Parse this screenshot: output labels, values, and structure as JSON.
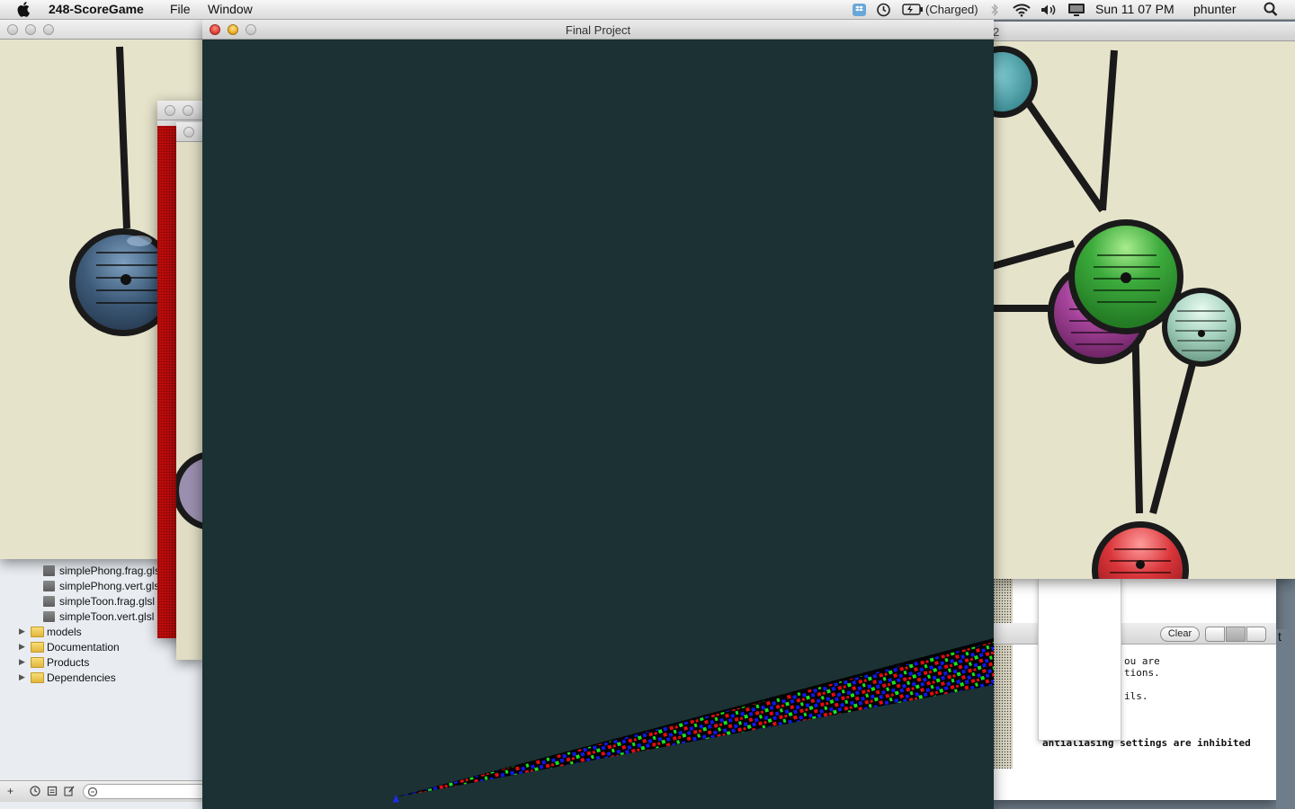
{
  "menubar": {
    "app_name": "248-ScoreGame",
    "menus": [
      "File",
      "Window"
    ],
    "battery_status": "(Charged)",
    "clock": "Sun 11 07 PM",
    "user": "phunter",
    "icons": [
      "apple-icon",
      "dropbox-icon",
      "time-machine-icon",
      "battery-icon",
      "bluetooth-icon",
      "wifi-icon",
      "volume-icon",
      "display-icon",
      "spotlight-icon"
    ]
  },
  "final_window": {
    "title": "Final Project",
    "background": "#1b3134"
  },
  "navigator": {
    "files": [
      "simplePhong.frag.glsl",
      "simplePhong.vert.glsl",
      "simpleToon.frag.glsl",
      "simpleToon.vert.glsl"
    ],
    "folders": [
      "models",
      "Documentation",
      "Products",
      "Dependencies"
    ]
  },
  "right_score": {
    "title_fragment": "2",
    "node_colors": [
      "#3cab3c",
      "#a6449b",
      "#a7d3c0",
      "#d9353a",
      "#4aa3ad"
    ]
  },
  "left_score": {
    "node_colors": [
      "#3d5a78",
      "#9a8fae"
    ]
  },
  "console": {
    "clear_label": "Clear",
    "lines": [
      "ou are",
      "tions.",
      "ils.",
      "antialiasing settings are inhibited"
    ],
    "corner_fragment": "t"
  }
}
